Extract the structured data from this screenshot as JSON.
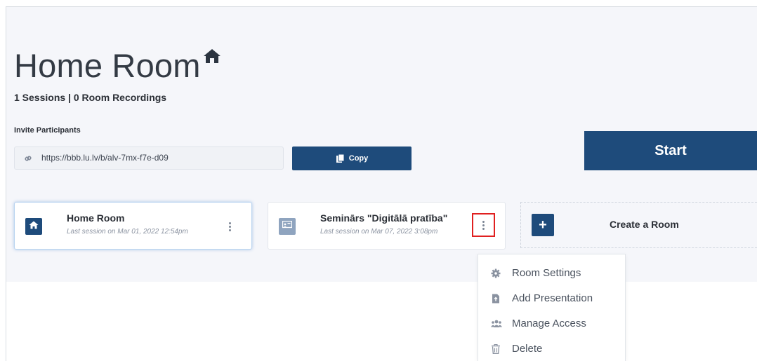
{
  "page": {
    "title": "Home Room",
    "stats": "1 Sessions | 0 Room Recordings"
  },
  "invite": {
    "label": "Invite Participants",
    "url": "https://bbb.lu.lv/b/alv-7mx-f7e-d09",
    "copy_label": "Copy"
  },
  "start_label": "Start",
  "rooms": [
    {
      "name": "Home Room",
      "last_session": "Last session on Mar 01, 2022 12:54pm",
      "icon": "home-icon"
    },
    {
      "name": "Seminārs \"Digitālā pratība\"",
      "last_session": "Last session on Mar 07, 2022 3:08pm",
      "icon": "presentation-icon"
    }
  ],
  "create_room": {
    "plus": "+",
    "label": "Create a Room"
  },
  "room_menu": {
    "items": [
      {
        "label": "Room Settings",
        "icon": "gear-icon"
      },
      {
        "label": "Add Presentation",
        "icon": "file-upload-icon"
      },
      {
        "label": "Manage Access",
        "icon": "users-icon"
      },
      {
        "label": "Delete",
        "icon": "trash-icon"
      }
    ]
  },
  "colors": {
    "primary": "#1e4b7b",
    "background": "#f5f6fa",
    "muted_icon": "#8fa4bf",
    "highlight": "#e02020"
  }
}
